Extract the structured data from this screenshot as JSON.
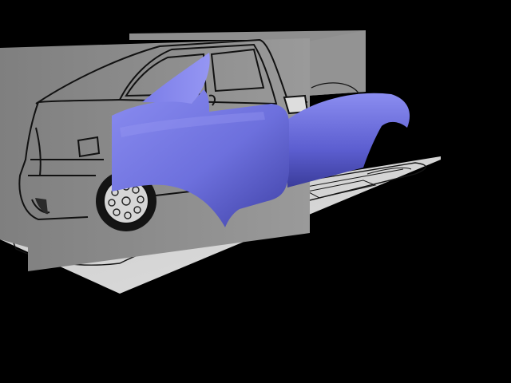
{
  "app": {
    "view_label": "",
    "colors": {
      "background": "#000000",
      "reference_plane": "#8f8f8f",
      "reference_plane_light": "#cfcfcf",
      "blueprint_line": "#151515",
      "surface_light": "#8a8cf0",
      "surface_mid": "#6b6ddb",
      "surface_dark": "#3a3c9a"
    }
  },
  "scene": {
    "objects": [
      {
        "name": "side-view-reference-plane",
        "kind": "image-plane"
      },
      {
        "name": "rear-view-reference-plane",
        "kind": "image-plane"
      },
      {
        "name": "top-view-reference-plane",
        "kind": "image-plane"
      },
      {
        "name": "car-body-surface",
        "kind": "nurbs-surface"
      }
    ]
  }
}
